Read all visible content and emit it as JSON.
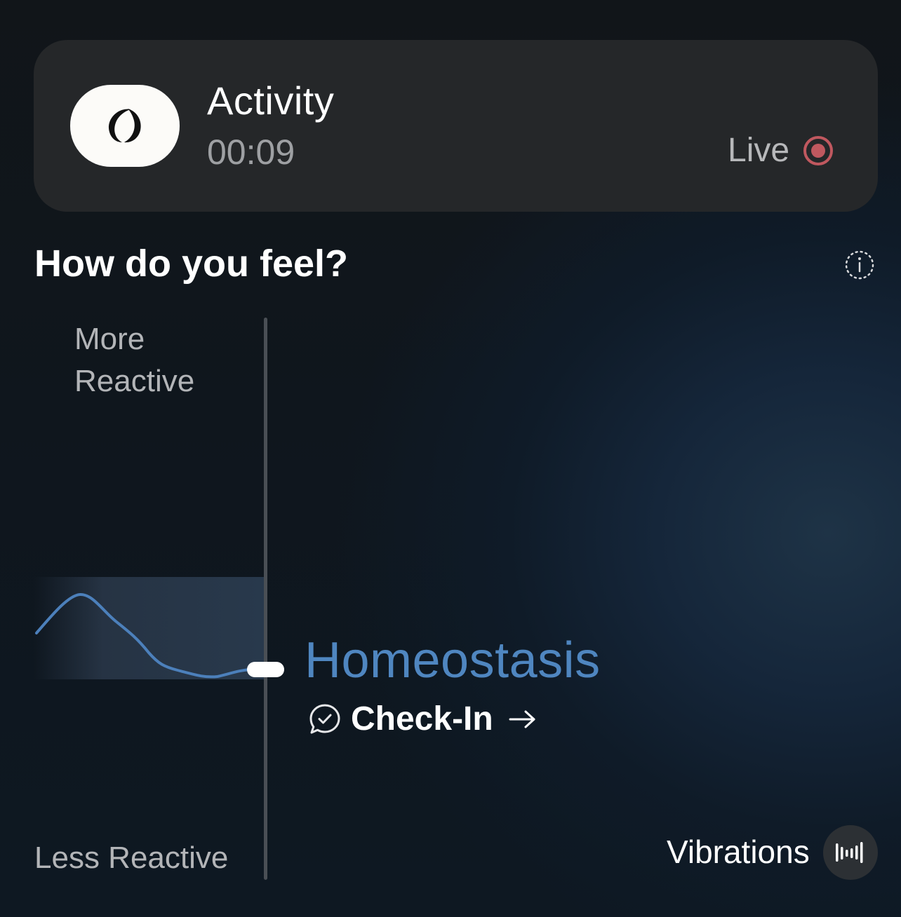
{
  "activity": {
    "title": "Activity",
    "timer": "00:09",
    "status_label": "Live",
    "app_icon": "crescent-logo-icon",
    "status_icon": "record-dot-icon",
    "live_color": "#c0585f"
  },
  "prompt": {
    "heading": "How do you feel?",
    "info_icon": "info-icon"
  },
  "scale": {
    "top_label_line1": "More",
    "top_label_line2": "Reactive",
    "bottom_label": "Less Reactive"
  },
  "state": {
    "label": "Homeostasis",
    "color": "#4f86c0",
    "checkin_label": "Check-In",
    "checkin_icon": "chat-check-icon",
    "arrow_icon": "arrow-right-icon"
  },
  "vibrations": {
    "label": "Vibrations",
    "icon": "sound-wave-icon"
  }
}
